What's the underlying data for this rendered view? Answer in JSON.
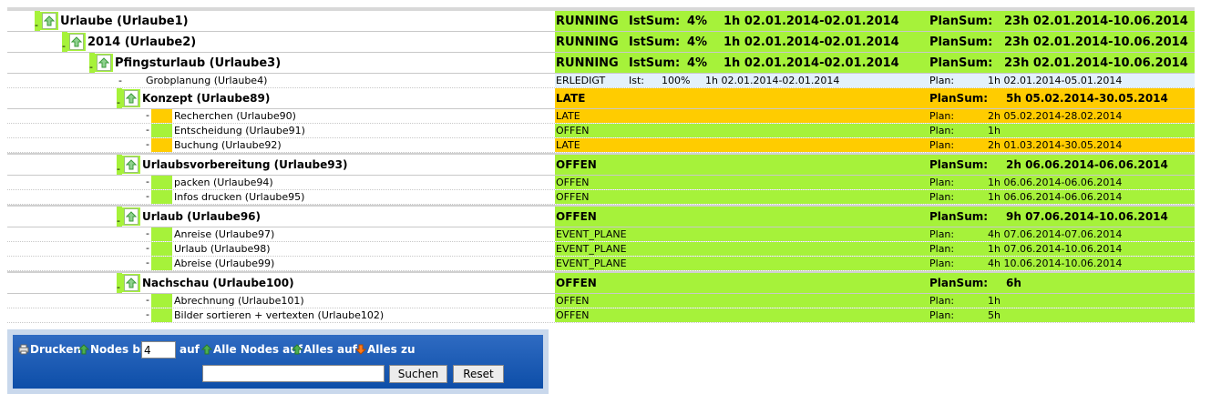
{
  "tree": [
    {
      "name": "Urlaube (Urlaube1)",
      "level": 0,
      "type": "node",
      "status": "RUNNING",
      "ist_label": "IstSum:",
      "ist_pct": "4%",
      "ist_time": "1h 02.01.2014-02.01.2014",
      "plan_label": "PlanSum:",
      "plan": "23h 02.01.2014-10.06.2014",
      "color": "green"
    },
    {
      "name": "2014 (Urlaube2)",
      "level": 1,
      "type": "node",
      "status": "RUNNING",
      "ist_label": "IstSum:",
      "ist_pct": "4%",
      "ist_time": "1h 02.01.2014-02.01.2014",
      "plan_label": "PlanSum:",
      "plan": "23h 02.01.2014-10.06.2014",
      "color": "green"
    },
    {
      "name": "Pfingsturlaub (Urlaube3)",
      "level": 2,
      "type": "node",
      "status": "RUNNING",
      "ist_label": "IstSum:",
      "ist_pct": "4%",
      "ist_time": "1h 02.01.2014-02.01.2014",
      "plan_label": "PlanSum:",
      "plan": "23h 02.01.2014-10.06.2014",
      "color": "green"
    },
    {
      "name": "Grobplanung (Urlaube4)",
      "level": 3,
      "type": "leaf3",
      "status": "ERLEDIGT",
      "ist_label": "Ist:",
      "ist_pct": "100%",
      "ist_time": "1h 02.01.2014-02.01.2014",
      "plan_label": "Plan:",
      "plan": "1h 02.01.2014-05.01.2014",
      "color": "blue"
    },
    {
      "name": "Konzept (Urlaube89)",
      "level": 3,
      "type": "node",
      "status": "LATE",
      "plan_label": "PlanSum:",
      "plan": "5h 05.02.2014-30.05.2014",
      "color": "orange"
    },
    {
      "name": "Recherchen (Urlaube90)",
      "level": 4,
      "type": "leaf",
      "status": "LATE",
      "plan_label": "Plan:",
      "plan": "2h 05.02.2014-28.02.2014",
      "color": "orange"
    },
    {
      "name": "Entscheidung (Urlaube91)",
      "level": 4,
      "type": "leaf",
      "status": "OFFEN",
      "plan_label": "Plan:",
      "plan": "1h",
      "color": "green"
    },
    {
      "name": "Buchung (Urlaube92)",
      "level": 4,
      "type": "leaf",
      "status": "LATE",
      "plan_label": "Plan:",
      "plan": "2h 01.03.2014-30.05.2014",
      "color": "orange"
    },
    {
      "name": "Urlaubsvorbereitung (Urlaube93)",
      "level": 3,
      "type": "node",
      "status": "OFFEN",
      "plan_label": "PlanSum:",
      "plan": "2h 06.06.2014-06.06.2014",
      "color": "green"
    },
    {
      "name": "packen (Urlaube94)",
      "level": 4,
      "type": "leaf",
      "status": "OFFEN",
      "plan_label": "Plan:",
      "plan": "1h 06.06.2014-06.06.2014",
      "color": "green"
    },
    {
      "name": "Infos drucken (Urlaube95)",
      "level": 4,
      "type": "leaf",
      "status": "OFFEN",
      "plan_label": "Plan:",
      "plan": "1h 06.06.2014-06.06.2014",
      "color": "green"
    },
    {
      "name": "Urlaub (Urlaube96)",
      "level": 3,
      "type": "node",
      "status": "OFFEN",
      "plan_label": "PlanSum:",
      "plan": "9h 07.06.2014-10.06.2014",
      "color": "green"
    },
    {
      "name": "Anreise (Urlaube97)",
      "level": 4,
      "type": "leaf",
      "status": "EVENT_PLANE",
      "plan_label": "Plan:",
      "plan": "4h 07.06.2014-07.06.2014",
      "color": "green"
    },
    {
      "name": "Urlaub (Urlaube98)",
      "level": 4,
      "type": "leaf",
      "status": "EVENT_PLANE",
      "plan_label": "Plan:",
      "plan": "1h 07.06.2014-10.06.2014",
      "color": "green"
    },
    {
      "name": "Abreise (Urlaube99)",
      "level": 4,
      "type": "leaf",
      "status": "EVENT_PLANE",
      "plan_label": "Plan:",
      "plan": "4h 10.06.2014-10.06.2014",
      "color": "green"
    },
    {
      "name": "Nachschau (Urlaube100)",
      "level": 3,
      "type": "node",
      "status": "OFFEN",
      "plan_label": "PlanSum:",
      "plan": "6h",
      "color": "green"
    },
    {
      "name": "Abrechnung (Urlaube101)",
      "level": 4,
      "type": "leaf",
      "status": "OFFEN",
      "plan_label": "Plan:",
      "plan": "1h",
      "color": "green"
    },
    {
      "name": "Bilder sortieren + vertexten (Urlaube102)",
      "level": 4,
      "type": "leaf",
      "status": "OFFEN",
      "plan_label": "Plan:",
      "plan": "5h",
      "color": "green"
    }
  ],
  "toolbar": {
    "print_label": "Drucken",
    "nodes_label": "Nodes bis",
    "nodes_value": "4",
    "nodes_suffix": "auf",
    "all_nodes_open": "Alle Nodes auf",
    "all_open": "Alles auf",
    "all_close": "Alles zu",
    "search_value": "",
    "search_button": "Suchen",
    "reset_button": "Reset"
  },
  "colors": {
    "green": "#a6f23a",
    "orange": "#ffcc00",
    "blue": "#e3f1fb",
    "toolbar": "#0d4ea8"
  }
}
